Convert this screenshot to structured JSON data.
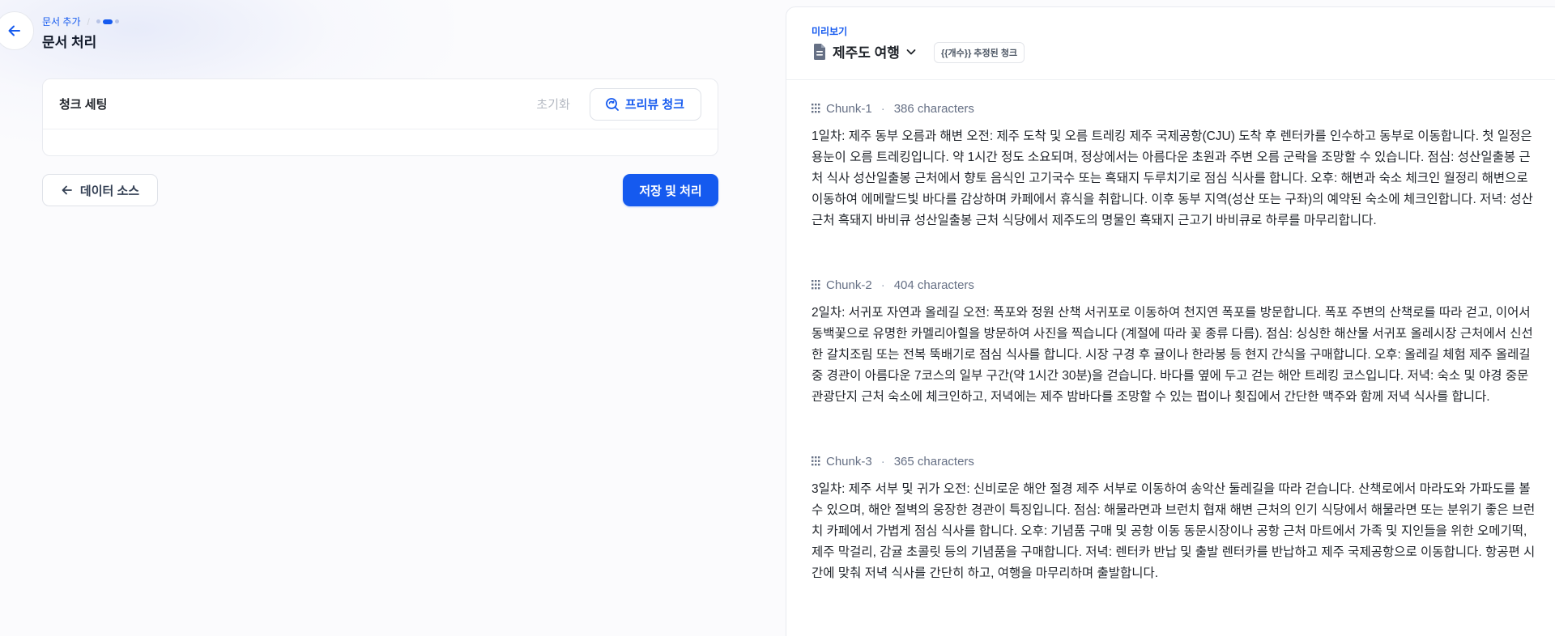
{
  "header": {
    "breadcrumb": "문서 추가",
    "breadcrumb_sep": "/",
    "title": "문서 처리"
  },
  "chunk_settings": {
    "title": "청크 세팅",
    "reset_label": "초기화",
    "preview_label": "프리뷰 청크"
  },
  "footer": {
    "back_label": "데이터 소스",
    "save_label": "저장 및 처리"
  },
  "preview": {
    "label": "미리보기",
    "document_name": "제주도 여행",
    "estimate_badge": "{{개수}} 추정된 청크",
    "chunks": [
      {
        "name": "Chunk-1",
        "chars": "386 characters",
        "text": "1일차: 제주 동부 오름과 해변 오전: 제주 도착 및 오름 트레킹 제주 국제공항(CJU) 도착 후 렌터카를 인수하고 동부로 이동합니다. 첫 일정은 용눈이 오름 트레킹입니다. 약 1시간 정도 소요되며, 정상에서는 아름다운 초원과 주변 오름 군락을 조망할 수 있습니다. 점심: 성산일출봉 근처 식사 성산일출봉 근처에서 향토 음식인 고기국수 또는 흑돼지 두루치기로 점심 식사를 합니다. 오후: 해변과 숙소 체크인 월정리 해변으로 이동하여 에메랄드빛 바다를 감상하며 카페에서 휴식을 취합니다. 이후 동부 지역(성산 또는 구좌)의 예약된 숙소에 체크인합니다. 저녁: 성산 근처 흑돼지 바비큐 성산일출봉 근처 식당에서 제주도의 명물인 흑돼지 근고기 바비큐로 하루를 마무리합니다."
      },
      {
        "name": "Chunk-2",
        "chars": "404 characters",
        "text": "2일차: 서귀포 자연과 올레길 오전: 폭포와 정원 산책 서귀포로 이동하여 천지연 폭포를 방문합니다. 폭포 주변의 산책로를 따라 걷고, 이어서 동백꽃으로 유명한 카멜리아힐을 방문하여 사진을 찍습니다 (계절에 따라 꽃 종류 다름). 점심: 싱싱한 해산물 서귀포 올레시장 근처에서 신선한 갈치조림 또는 전복 뚝배기로 점심 식사를 합니다. 시장 구경 후 귤이나 한라봉 등 현지 간식을 구매합니다. 오후: 올레길 체험 제주 올레길 중 경관이 아름다운 7코스의 일부 구간(약 1시간 30분)을 걷습니다. 바다를 옆에 두고 걷는 해안 트레킹 코스입니다. 저녁: 숙소 및 야경 중문 관광단지 근처 숙소에 체크인하고, 저녁에는 제주 밤바다를 조망할 수 있는 펍이나 횟집에서 간단한 맥주와 함께 저녁 식사를 합니다."
      },
      {
        "name": "Chunk-3",
        "chars": "365 characters",
        "text": "3일차: 제주 서부 및 귀가 오전: 신비로운 해안 절경 제주 서부로 이동하여 송악산 둘레길을 따라 걷습니다. 산책로에서 마라도와 가파도를 볼 수 있으며, 해안 절벽의 웅장한 경관이 특징입니다. 점심: 해물라면과 브런치 협재 해변 근처의 인기 식당에서 해물라면 또는 분위기 좋은 브런치 카페에서 가볍게 점심 식사를 합니다. 오후: 기념품 구매 및 공항 이동 동문시장이나 공항 근처 마트에서 가족 및 지인들을 위한 오메기떡, 제주 막걸리, 감귤 초콜릿 등의 기념품을 구매합니다. 저녁: 렌터카 반납 및 출발 렌터카를 반납하고 제주 국제공항으로 이동합니다. 항공편 시간에 맞춰 저녁 식사를 간단히 하고, 여행을 마무리하며 출발합니다."
      }
    ]
  },
  "colors": {
    "accent": "#155aef",
    "text": "#1f2329",
    "muted": "#667085"
  }
}
